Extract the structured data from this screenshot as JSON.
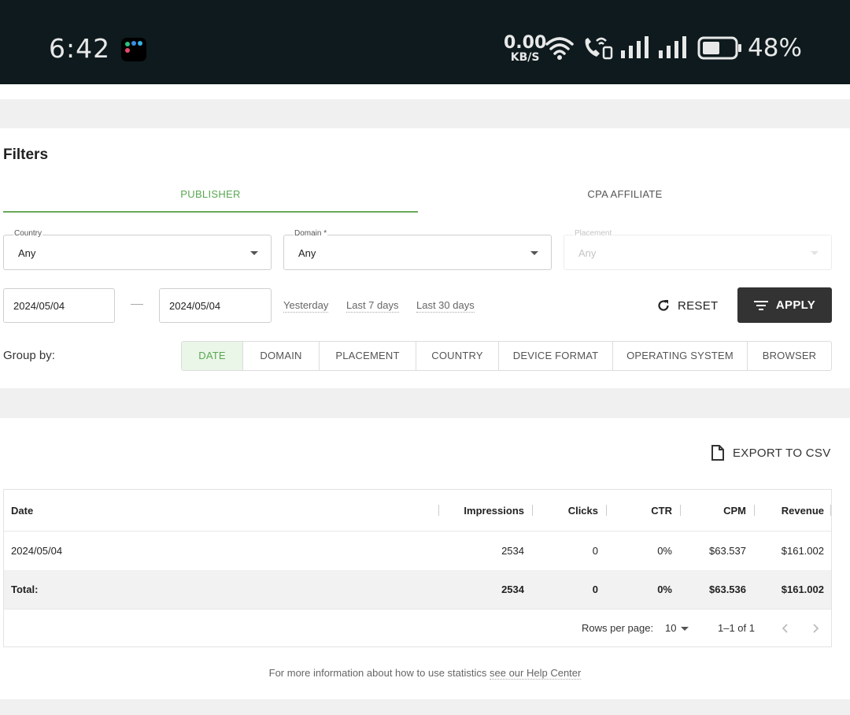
{
  "status_bar": {
    "time": "6:42",
    "net_speed": "0.00",
    "net_unit": "KB/S",
    "battery": "48%"
  },
  "filters": {
    "title": "Filters",
    "tabs": [
      {
        "label": "PUBLISHER",
        "active": true
      },
      {
        "label": "CPA AFFILIATE",
        "active": false
      }
    ],
    "country": {
      "label": "Country",
      "value": "Any"
    },
    "domain": {
      "label": "Domain *",
      "value": "Any"
    },
    "placement": {
      "label": "Placement",
      "value": "Any",
      "disabled": true
    },
    "date_from": "2024/05/04",
    "date_to": "2024/05/04",
    "quick_ranges": [
      "Yesterday",
      "Last 7 days",
      "Last 30 days"
    ],
    "reset_label": "RESET",
    "apply_label": "APPLY",
    "group_by_label": "Group by:",
    "group_by": [
      "DATE",
      "DOMAIN",
      "PLACEMENT",
      "COUNTRY",
      "DEVICE FORMAT",
      "OPERATING SYSTEM",
      "BROWSER"
    ],
    "group_by_active": "DATE"
  },
  "report": {
    "export_label": "EXPORT TO CSV",
    "columns": [
      "Date",
      "Impressions",
      "Clicks",
      "CTR",
      "CPM",
      "Revenue"
    ],
    "rows": [
      {
        "date": "2024/05/04",
        "impressions": "2534",
        "clicks": "0",
        "ctr": "0%",
        "cpm": "$63.537",
        "revenue": "$161.002"
      }
    ],
    "total": {
      "label": "Total:",
      "impressions": "2534",
      "clicks": "0",
      "ctr": "0%",
      "cpm": "$63.536",
      "revenue": "$161.002"
    },
    "pagination": {
      "rows_per_page_label": "Rows per page:",
      "rows_per_page": "10",
      "range": "1–1 of 1"
    }
  },
  "help": {
    "text": "For more information about how to use statistics ",
    "link": "see our Help Center"
  },
  "colors": {
    "accent_green": "#5aa752",
    "apply_bg": "#333333",
    "status_bar_bg": "#0e1a1d"
  }
}
